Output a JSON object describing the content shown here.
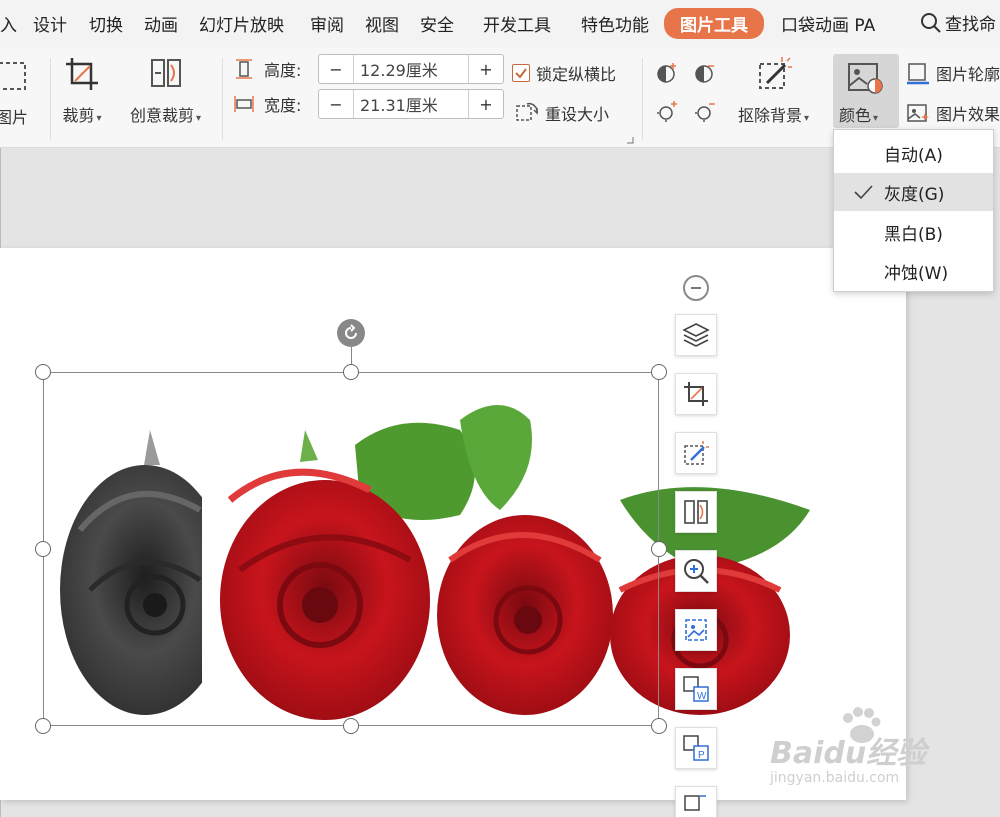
{
  "menu": {
    "items": [
      "入",
      "设计",
      "切换",
      "动画",
      "幻灯片放映",
      "审阅",
      "视图",
      "安全",
      "开发工具",
      "特色功能"
    ],
    "active_tab": "图片工具",
    "after_items": [
      "口袋动画 PA"
    ],
    "search": "查找命"
  },
  "ribbon": {
    "partial_left_label": "图片",
    "crop": "裁剪",
    "creative_crop": "创意裁剪",
    "height_label": "高度:",
    "height_value": "12.29厘米",
    "width_label": "宽度:",
    "width_value": "21.31厘米",
    "minus": "−",
    "plus": "+",
    "lock_ratio": "锁定纵横比",
    "reset_size": "重设大小",
    "remove_bg": "抠除背景",
    "color": "颜色",
    "pic_outline": "图片轮廓",
    "pic_effect": "图片效果"
  },
  "color_menu": {
    "items": [
      "自动(A)",
      "灰度(G)",
      "黑白(B)",
      "冲蚀(W)"
    ],
    "selected_index": 1
  },
  "watermark": {
    "main": "Baidu经验",
    "sub": "jingyan.baidu.com"
  },
  "colors": {
    "accent": "#e8754a",
    "rose_red": "#c8141c",
    "leaf_green": "#4f9a2e"
  }
}
